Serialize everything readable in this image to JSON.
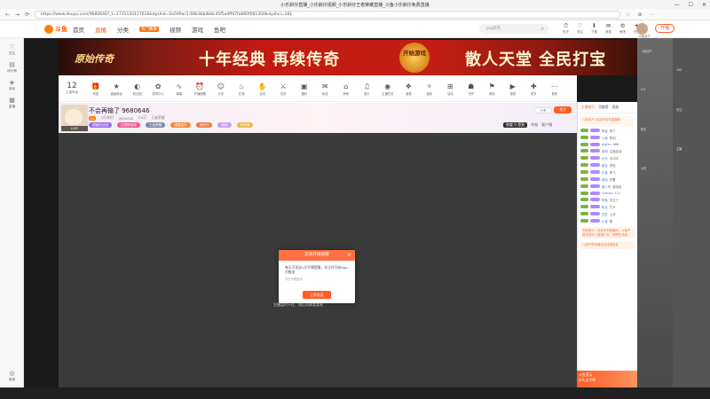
{
  "window": {
    "title": "小乐斜仔直播_小乐斜仔视频_小乐斜仔王者荣耀直播_斗鱼小乐斜仔免费直播",
    "controls": [
      "—",
      "☐",
      "✕"
    ]
  },
  "browser": {
    "url": "https://www.douyu.com/9680646?_t=1735150117616&dyshid=0a599ac1-84b3bb4b8c45f5a4ff47fa660f681350&dyshci=181",
    "nav": [
      "←",
      "→",
      "⟳"
    ],
    "right_icons": [
      "☆",
      "⊕",
      "⋯"
    ]
  },
  "header": {
    "logo_text": "斗鱼",
    "nav": [
      {
        "label": "首页",
        "active": false
      },
      {
        "label": "直播",
        "active": true
      },
      {
        "label": "分类",
        "active": false
      },
      {
        "label": "热门赛事",
        "active": false,
        "hot": true
      },
      {
        "label": "视频",
        "active": false
      },
      {
        "label": "游戏",
        "active": false
      },
      {
        "label": "鱼吧",
        "active": false
      }
    ],
    "search_placeholder": "pig系英",
    "icons": [
      {
        "glyph": "⏱",
        "label": "历史"
      },
      {
        "glyph": "♡",
        "label": "关注"
      },
      {
        "glyph": "⬇",
        "label": "下载"
      },
      {
        "glyph": "✉",
        "label": "消息"
      },
      {
        "glyph": "⚙",
        "label": "鱼吧"
      },
      {
        "glyph": "✦",
        "label": "任务"
      }
    ],
    "user_label": "斗鱼用户",
    "live_button": "开播"
  },
  "left_rail": {
    "items": [
      {
        "glyph": "♡",
        "label": "关注"
      },
      {
        "glyph": "▤",
        "label": "排行榜"
      },
      {
        "glyph": "◈",
        "label": "游戏"
      },
      {
        "glyph": "▦",
        "label": "直播"
      }
    ],
    "bottom": {
      "glyph": "◎",
      "label": "客服"
    }
  },
  "banner": {
    "game_title": "原始传奇",
    "slogan_left": "十年经典 再续传奇",
    "seal": "开始游戏",
    "slogan_right": "散人天堂 全民打宝"
  },
  "gifts": {
    "level": "12",
    "level_label": "主播等级",
    "items": [
      {
        "glyph": "🎁",
        "label": "贵族"
      },
      {
        "glyph": "★",
        "label": "超级粉丝"
      },
      {
        "glyph": "◐",
        "label": "粉丝团"
      },
      {
        "glyph": "✿",
        "label": "勋章中心"
      },
      {
        "glyph": "∿",
        "label": "弹幕"
      },
      {
        "glyph": "⏰",
        "label": "开播提醒"
      },
      {
        "glyph": "☺",
        "label": "分享"
      },
      {
        "glyph": "♨",
        "label": "礼物"
      },
      {
        "glyph": "✋",
        "label": "互动"
      },
      {
        "glyph": "⚔",
        "label": "任务"
      },
      {
        "glyph": "▣",
        "label": "福利"
      },
      {
        "glyph": "✉",
        "label": "私信"
      },
      {
        "glyph": "⌂",
        "label": "房间"
      },
      {
        "glyph": "♫",
        "label": "音乐"
      },
      {
        "glyph": "◉",
        "label": "主播任务"
      },
      {
        "glyph": "❖",
        "label": "宝箱"
      },
      {
        "glyph": "✧",
        "label": "抽奖"
      },
      {
        "glyph": "⊞",
        "label": "活动"
      },
      {
        "glyph": "☗",
        "label": "守护"
      },
      {
        "glyph": "⚑",
        "label": "竞猜"
      },
      {
        "glyph": "▶",
        "label": "视频"
      },
      {
        "glyph": "✚",
        "label": "更多"
      },
      {
        "glyph": "⋯",
        "label": "更多"
      }
    ]
  },
  "anchor": {
    "avatar_tag": "LIVE",
    "room_title": "不会再输了 9680646",
    "meta": [
      "Lv",
      "小乐斜仔",
      "9680646",
      "3.8万",
      "王者荣耀"
    ],
    "tags": [
      {
        "label": "超级粉丝团",
        "color": "#9c6cf0"
      },
      {
        "label": "礼物榜冠军",
        "color": "#ef5b8c"
      },
      {
        "label": "王者荣耀",
        "color": "#7a8aa6"
      },
      {
        "label": "国服选手",
        "color": "#f08a3c"
      },
      {
        "label": "老斜仔",
        "color": "#f07a4a"
      },
      {
        "label": "铁粉",
        "color": "#c9a0f0"
      },
      {
        "label": "好声音",
        "color": "#e8b64a"
      }
    ],
    "follow_label": "分享",
    "subscribe_label": "关注",
    "heat_label": "热度 0 签到",
    "reports": [
      "举报",
      "客户端"
    ]
  },
  "player": {
    "hint": "主播暂时不在，稍后再来看看吧"
  },
  "modal": {
    "title": "友情开播提醒",
    "close": "×",
    "body": "每天可发送1次开播提醒，关注并开启App内推送",
    "checkbox": "今日不再提示",
    "button": "立即发送"
  },
  "chat": {
    "rank_tabs": [
      {
        "label": "主播排行",
        "active": true
      },
      {
        "label": "贡献榜",
        "active": false
      },
      {
        "label": "贵族",
        "active": false
      }
    ],
    "notice": "斗鱼用户 欢迎来到本直播间",
    "messages": [
      {
        "nick": "阿金",
        "text": "来了"
      },
      {
        "nick": "小鱼",
        "text": "签到"
      },
      {
        "nick": "pigfan",
        "text": "666"
      },
      {
        "nick": "老斜",
        "text": "主播加油"
      },
      {
        "nick": "乐乐",
        "text": "冲冲冲"
      },
      {
        "nick": "鱼友",
        "text": "来啦"
      },
      {
        "nick": "王者",
        "text": "带飞"
      },
      {
        "nick": "哈哈",
        "text": "好看"
      },
      {
        "nick": "路人甲",
        "text": "哈哈哈"
      },
      {
        "nick": "Orange",
        "text": "111"
      },
      {
        "nick": "阿鱼",
        "text": "关注了"
      },
      {
        "nick": "粉丝",
        "text": "打卡"
      },
      {
        "nick": "豆豆",
        "text": "上分"
      },
      {
        "nick": "小宝",
        "text": "稳"
      }
    ],
    "system_msg": "系统提示：欢迎来到直播间，斗鱼严禁未成年人直播打赏，请理性消费。",
    "system_msg2": "斗鱼严禁传播违法违规信息",
    "ad_title": "斗鱼提示",
    "ad_text": "好礼送不停"
  },
  "far_right": {
    "lines": [
      "斗鱼用户",
      "100",
      "LV1",
      "关注",
      "粉丝",
      "主播",
      "公告"
    ]
  }
}
